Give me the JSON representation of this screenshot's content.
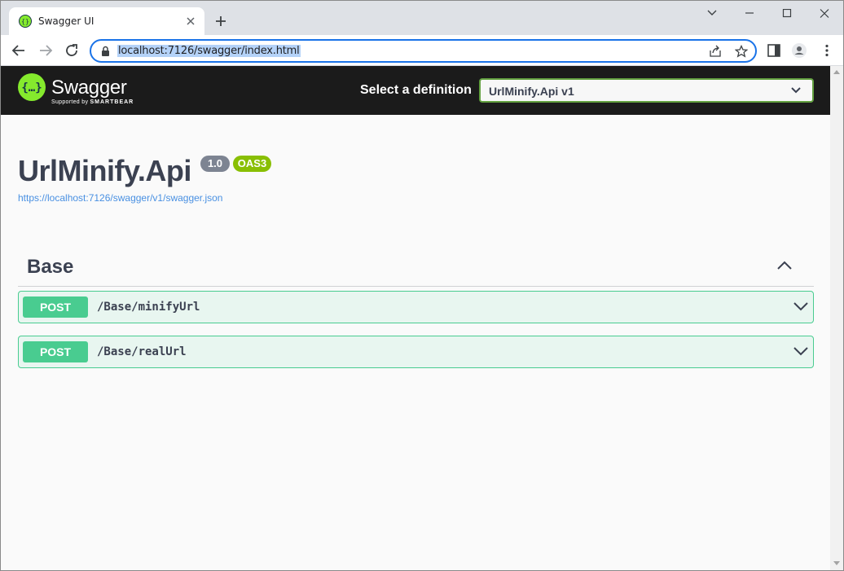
{
  "browser": {
    "tab_title": "Swagger UI",
    "url": "localhost:7126/swagger/index.html"
  },
  "swagger": {
    "brand": "Swagger",
    "brand_sub_prefix": "Supported by",
    "brand_sub_company": "SMARTBEAR",
    "definition_label": "Select a definition",
    "definition_selected": "UrlMinify.Api v1"
  },
  "info": {
    "title": "UrlMinify.Api",
    "version": "1.0",
    "oas": "OAS3",
    "spec_url": "https://localhost:7126/swagger/v1/swagger.json"
  },
  "tag": {
    "name": "Base"
  },
  "operations": [
    {
      "method": "POST",
      "path": "/Base/minifyUrl"
    },
    {
      "method": "POST",
      "path": "/Base/realUrl"
    }
  ],
  "colors": {
    "post_green": "#49cc90",
    "post_bg": "#e8f6f0",
    "topbar": "#1b1b1b",
    "logo_green": "#85ea2d",
    "oas_badge": "#89bf04",
    "version_badge": "#7d8492",
    "link_blue": "#4990e2"
  }
}
